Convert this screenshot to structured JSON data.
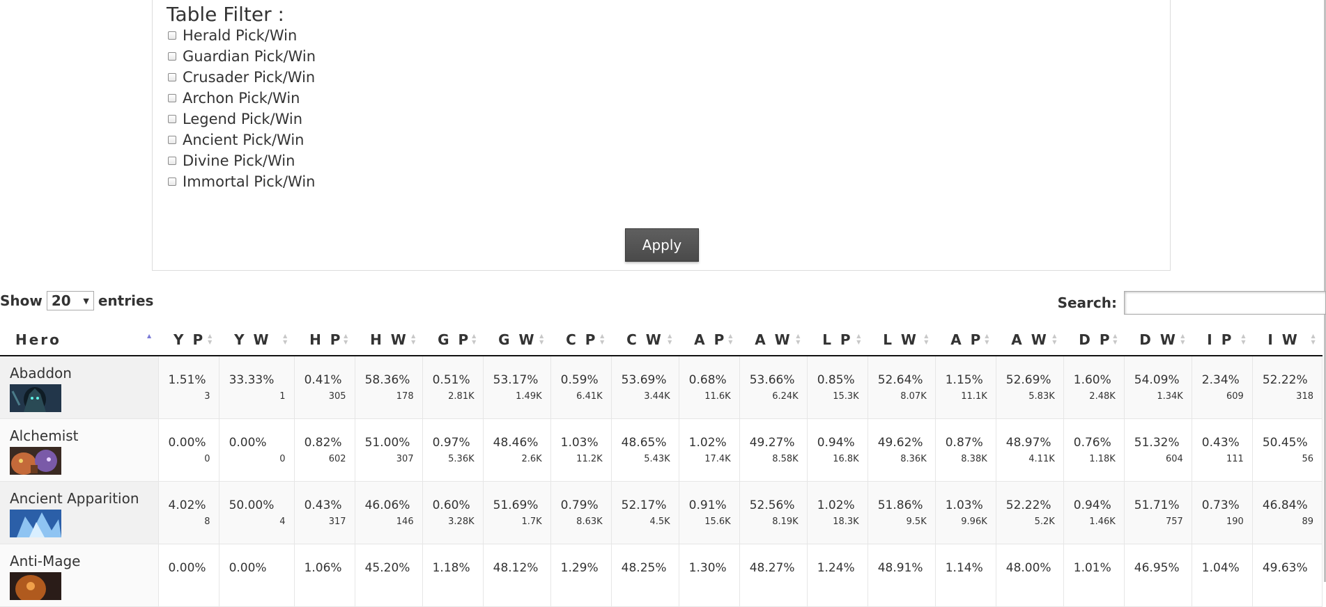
{
  "filter": {
    "title": "Table Filter :",
    "options": [
      {
        "label": "Herald Pick/Win",
        "checked": false
      },
      {
        "label": "Guardian Pick/Win",
        "checked": false
      },
      {
        "label": "Crusader Pick/Win",
        "checked": false
      },
      {
        "label": "Archon Pick/Win",
        "checked": false
      },
      {
        "label": "Legend Pick/Win",
        "checked": false
      },
      {
        "label": "Ancient Pick/Win",
        "checked": false
      },
      {
        "label": "Divine Pick/Win",
        "checked": false
      },
      {
        "label": "Immortal Pick/Win",
        "checked": false
      }
    ],
    "apply_label": "Apply"
  },
  "controls": {
    "show_label": "Show",
    "entries_value": "20",
    "entries_label": "entries",
    "search_label": "Search:",
    "search_value": ""
  },
  "table": {
    "columns": [
      "Hero",
      "Y P",
      "Y W",
      "H P",
      "H W",
      "G P",
      "G W",
      "C P",
      "C W",
      "A P",
      "A W",
      "L P",
      "L W",
      "A P",
      "A W",
      "D P",
      "D W",
      "I P",
      "I W"
    ],
    "sorted_column": "Hero",
    "rows": [
      {
        "hero": "Abaddon",
        "image": "abaddon-portrait",
        "cells": [
          {
            "pct": "1.51%",
            "count": "3"
          },
          {
            "pct": "33.33%",
            "count": "1"
          },
          {
            "pct": "0.41%",
            "count": "305"
          },
          {
            "pct": "58.36%",
            "count": "178"
          },
          {
            "pct": "0.51%",
            "count": "2.81K"
          },
          {
            "pct": "53.17%",
            "count": "1.49K"
          },
          {
            "pct": "0.59%",
            "count": "6.41K"
          },
          {
            "pct": "53.69%",
            "count": "3.44K"
          },
          {
            "pct": "0.68%",
            "count": "11.6K"
          },
          {
            "pct": "53.66%",
            "count": "6.24K"
          },
          {
            "pct": "0.85%",
            "count": "15.3K"
          },
          {
            "pct": "52.64%",
            "count": "8.07K"
          },
          {
            "pct": "1.15%",
            "count": "11.1K"
          },
          {
            "pct": "52.69%",
            "count": "5.83K"
          },
          {
            "pct": "1.60%",
            "count": "2.48K"
          },
          {
            "pct": "54.09%",
            "count": "1.34K"
          },
          {
            "pct": "2.34%",
            "count": "609"
          },
          {
            "pct": "52.22%",
            "count": "318"
          }
        ]
      },
      {
        "hero": "Alchemist",
        "image": "alchemist-portrait",
        "cells": [
          {
            "pct": "0.00%",
            "count": "0"
          },
          {
            "pct": "0.00%",
            "count": "0"
          },
          {
            "pct": "0.82%",
            "count": "602"
          },
          {
            "pct": "51.00%",
            "count": "307"
          },
          {
            "pct": "0.97%",
            "count": "5.36K"
          },
          {
            "pct": "48.46%",
            "count": "2.6K"
          },
          {
            "pct": "1.03%",
            "count": "11.2K"
          },
          {
            "pct": "48.65%",
            "count": "5.43K"
          },
          {
            "pct": "1.02%",
            "count": "17.4K"
          },
          {
            "pct": "49.27%",
            "count": "8.58K"
          },
          {
            "pct": "0.94%",
            "count": "16.8K"
          },
          {
            "pct": "49.62%",
            "count": "8.36K"
          },
          {
            "pct": "0.87%",
            "count": "8.38K"
          },
          {
            "pct": "48.97%",
            "count": "4.11K"
          },
          {
            "pct": "0.76%",
            "count": "1.18K"
          },
          {
            "pct": "51.32%",
            "count": "604"
          },
          {
            "pct": "0.43%",
            "count": "111"
          },
          {
            "pct": "50.45%",
            "count": "56"
          }
        ]
      },
      {
        "hero": "Ancient Apparition",
        "image": "ancient-apparition-portrait",
        "cells": [
          {
            "pct": "4.02%",
            "count": "8"
          },
          {
            "pct": "50.00%",
            "count": "4"
          },
          {
            "pct": "0.43%",
            "count": "317"
          },
          {
            "pct": "46.06%",
            "count": "146"
          },
          {
            "pct": "0.60%",
            "count": "3.28K"
          },
          {
            "pct": "51.69%",
            "count": "1.7K"
          },
          {
            "pct": "0.79%",
            "count": "8.63K"
          },
          {
            "pct": "52.17%",
            "count": "4.5K"
          },
          {
            "pct": "0.91%",
            "count": "15.6K"
          },
          {
            "pct": "52.56%",
            "count": "8.19K"
          },
          {
            "pct": "1.02%",
            "count": "18.3K"
          },
          {
            "pct": "51.86%",
            "count": "9.5K"
          },
          {
            "pct": "1.03%",
            "count": "9.96K"
          },
          {
            "pct": "52.22%",
            "count": "5.2K"
          },
          {
            "pct": "0.94%",
            "count": "1.46K"
          },
          {
            "pct": "51.71%",
            "count": "757"
          },
          {
            "pct": "0.73%",
            "count": "190"
          },
          {
            "pct": "46.84%",
            "count": "89"
          }
        ]
      },
      {
        "hero": "Anti-Mage",
        "image": "anti-mage-portrait",
        "cells": [
          {
            "pct": "0.00%",
            "count": ""
          },
          {
            "pct": "0.00%",
            "count": ""
          },
          {
            "pct": "1.06%",
            "count": ""
          },
          {
            "pct": "45.20%",
            "count": ""
          },
          {
            "pct": "1.18%",
            "count": ""
          },
          {
            "pct": "48.12%",
            "count": ""
          },
          {
            "pct": "1.29%",
            "count": ""
          },
          {
            "pct": "48.25%",
            "count": ""
          },
          {
            "pct": "1.30%",
            "count": ""
          },
          {
            "pct": "48.27%",
            "count": ""
          },
          {
            "pct": "1.24%",
            "count": ""
          },
          {
            "pct": "48.91%",
            "count": ""
          },
          {
            "pct": "1.14%",
            "count": ""
          },
          {
            "pct": "48.00%",
            "count": ""
          },
          {
            "pct": "1.01%",
            "count": ""
          },
          {
            "pct": "46.95%",
            "count": ""
          },
          {
            "pct": "1.04%",
            "count": ""
          },
          {
            "pct": "49.63%",
            "count": ""
          }
        ]
      }
    ]
  }
}
